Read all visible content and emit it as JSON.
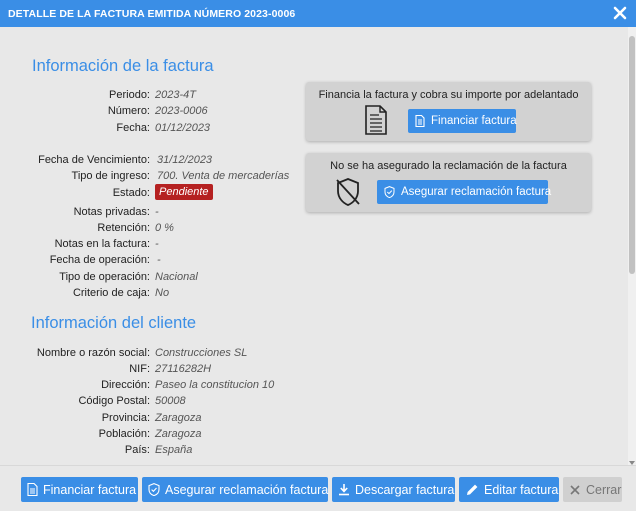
{
  "window": {
    "title": "DETALLE DE LA FACTURA EMITIDA NÚMERO 2023-0006",
    "close_icon": "close-icon"
  },
  "factura": {
    "section_title": "Información de la factura",
    "rows": [
      {
        "label": "Periodo:",
        "value": "2023-4T"
      },
      {
        "label": "Número:",
        "value": "2023-0006"
      },
      {
        "label": "Fecha:",
        "value": "01/12/2023"
      },
      {
        "label": "Fecha de Vencimiento:",
        "value": "31/12/2023"
      },
      {
        "label": "Tipo de ingreso:",
        "value": "700. Venta de mercaderías"
      },
      {
        "label": "Estado:",
        "value": "Pendiente"
      },
      {
        "label": "Notas privadas:",
        "value": "-"
      },
      {
        "label": "Retención:",
        "value": "0 %"
      },
      {
        "label": "Notas en la factura:",
        "value": "-"
      },
      {
        "label": "Fecha de operación:",
        "value": "-"
      },
      {
        "label": "Tipo de operación:",
        "value": "Nacional"
      },
      {
        "label": "Criterio de caja:",
        "value": "No"
      }
    ]
  },
  "cliente": {
    "section_title": "Información del cliente",
    "rows": [
      {
        "label": "Nombre o razón social:",
        "value": "Construcciones SL"
      },
      {
        "label": "NIF:",
        "value": "27116282H"
      },
      {
        "label": "Dirección:",
        "value": "Paseo la constitucion 10"
      },
      {
        "label": "Código Postal:",
        "value": "50008"
      },
      {
        "label": "Provincia:",
        "value": "Zaragoza"
      },
      {
        "label": "Población:",
        "value": "Zaragoza"
      },
      {
        "label": "País:",
        "value": "España"
      }
    ]
  },
  "cards": {
    "financiar": {
      "title": "Financia la factura y cobra su importe por adelantado",
      "button": "Financiar factura"
    },
    "asegurar": {
      "title": "No se ha asegurado la reclamación de la factura",
      "button": "Asegurar reclamación factura"
    }
  },
  "footer": {
    "financiar": "Financiar factura",
    "asegurar": "Asegurar reclamación factura",
    "descargar": "Descargar factura",
    "editar": "Editar factura",
    "cerrar": "Cerrar"
  },
  "colors": {
    "accent": "#3a8ee6",
    "status_pending": "#b52121"
  }
}
